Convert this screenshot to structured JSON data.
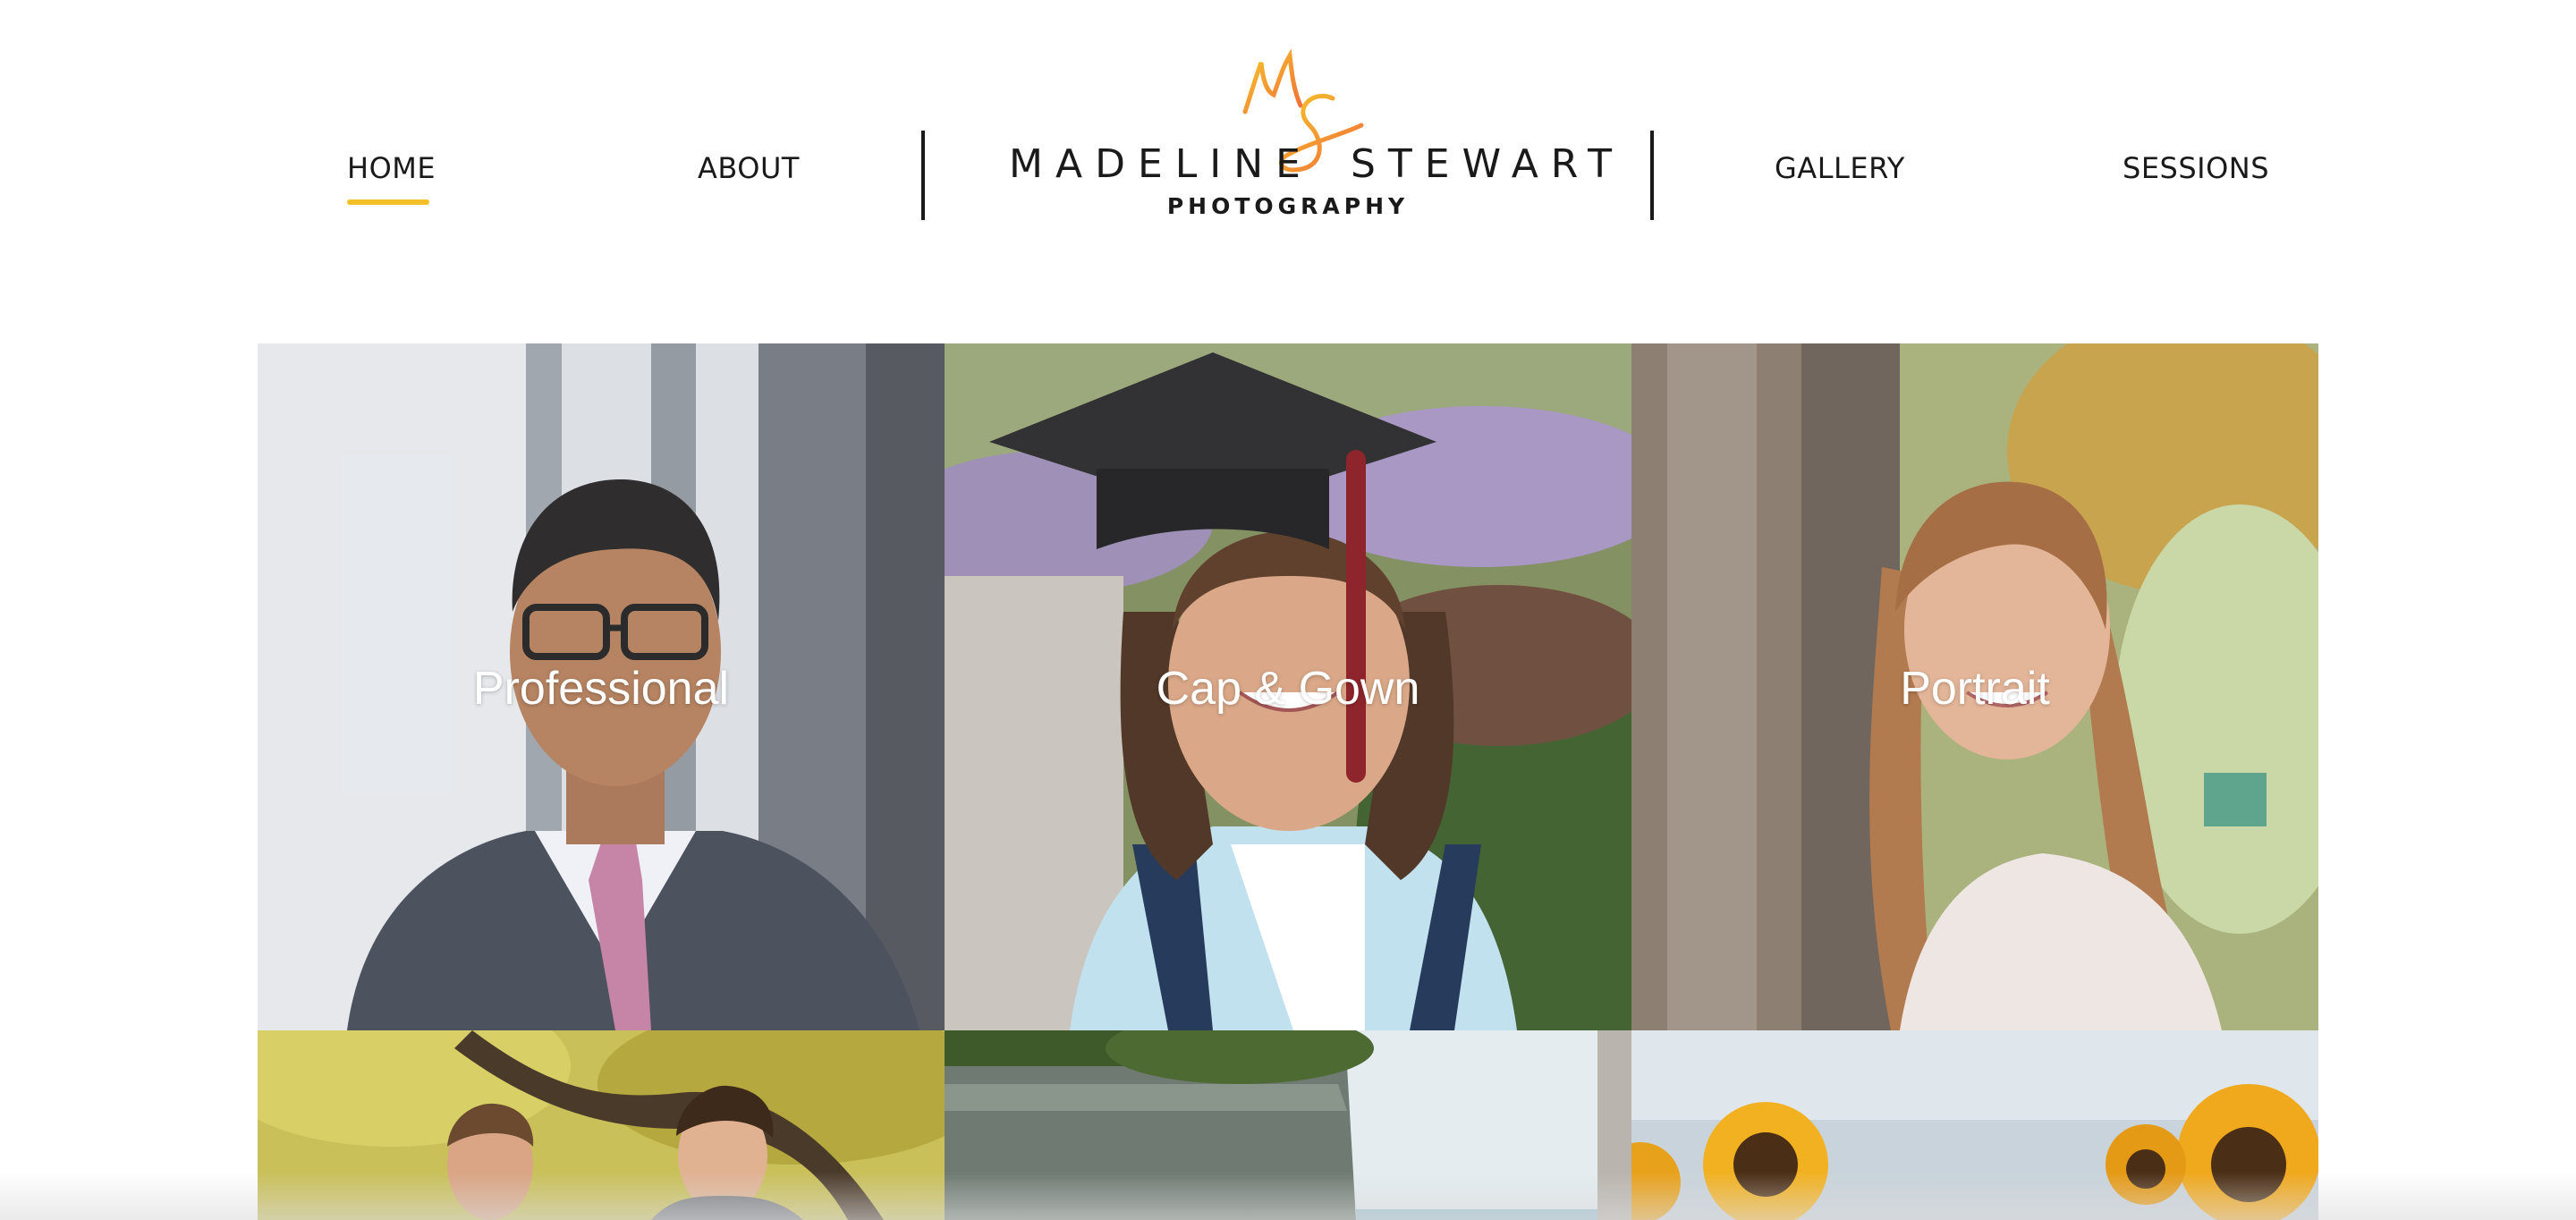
{
  "nav": {
    "home": "HOME",
    "about": "ABOUT",
    "gallery": "GALLERY",
    "sessions": "SESSIONS",
    "active": "HOME",
    "accent_color": "#f5bf2a"
  },
  "logo": {
    "first_name": "MADELINE",
    "last_name": "STEWART",
    "subtitle": "PHOTOGRAPHY",
    "monogram_colors": [
      "#f5bf2a",
      "#f26b3a"
    ]
  },
  "gallery": {
    "tiles": [
      {
        "label": "Professional"
      },
      {
        "label": "Cap & Gown"
      },
      {
        "label": "Portrait"
      }
    ]
  }
}
